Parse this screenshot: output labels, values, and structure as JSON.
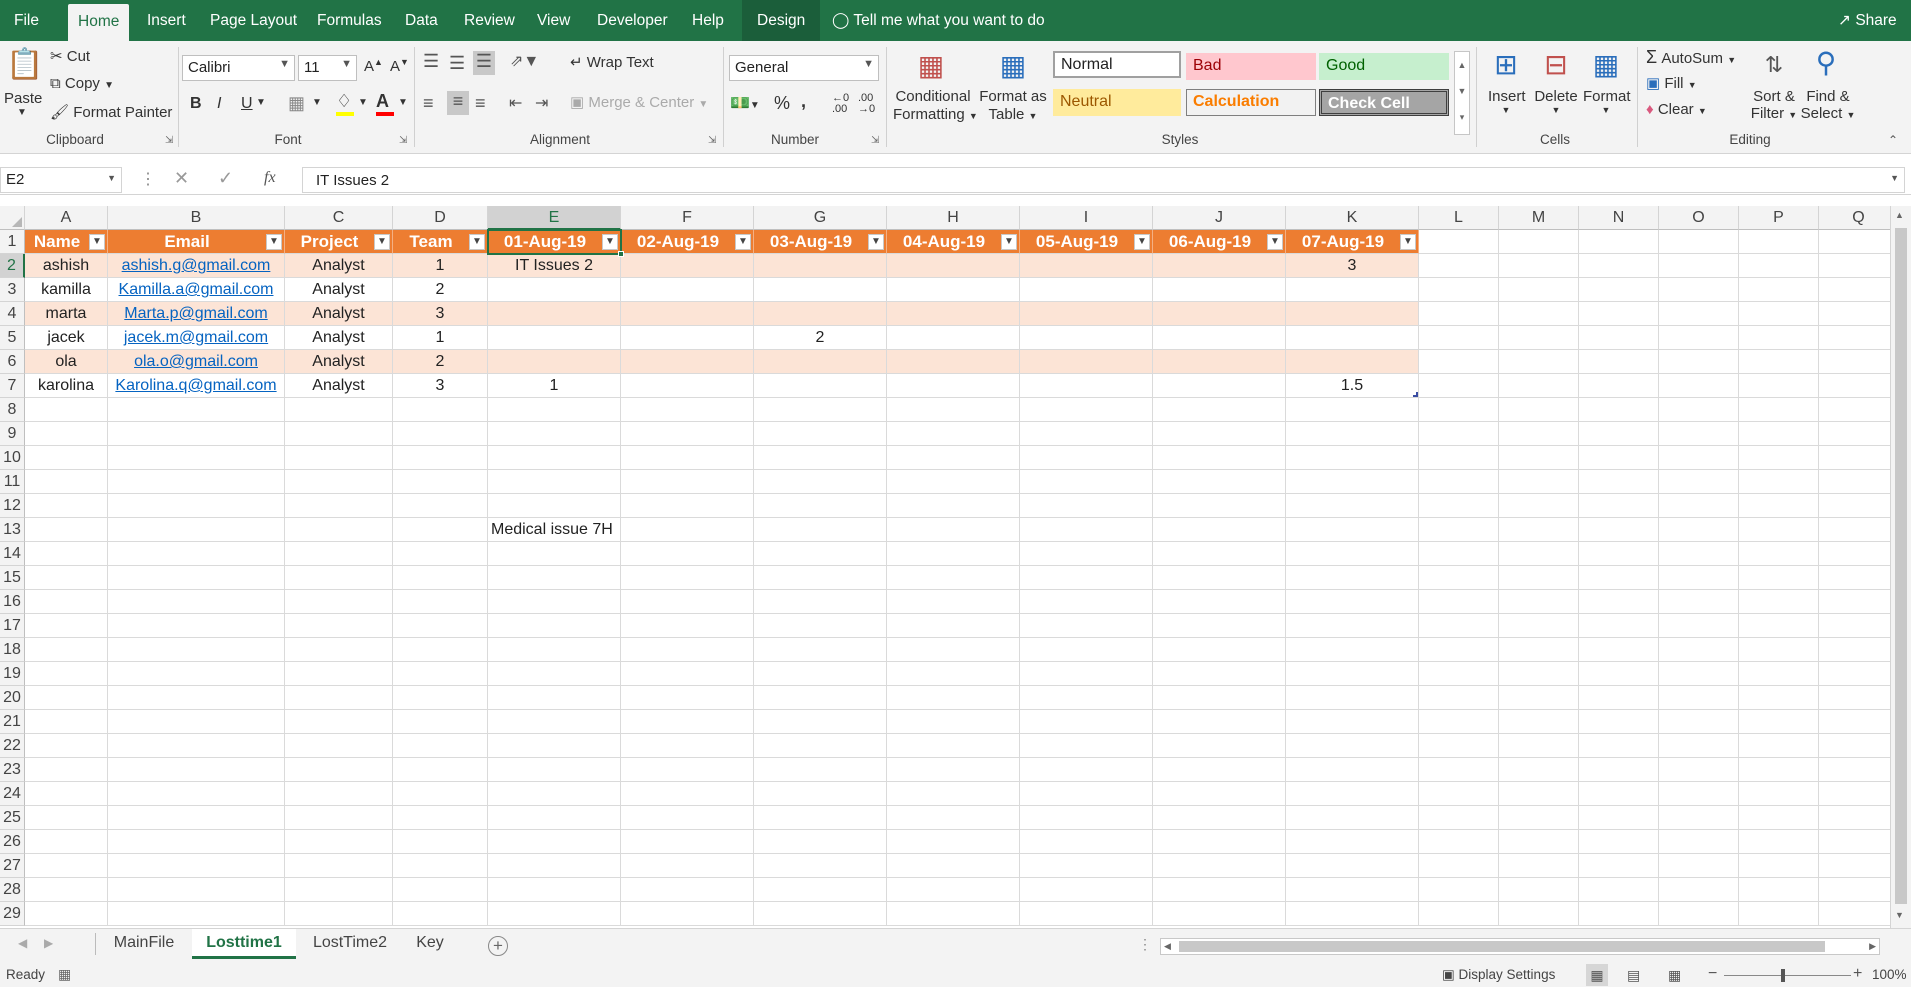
{
  "ribbon_tabs": [
    "File",
    "Home",
    "Insert",
    "Page Layout",
    "Formulas",
    "Data",
    "Review",
    "View",
    "Developer",
    "Help",
    "Design"
  ],
  "tell_me": "Tell me what you want to do",
  "share": "Share",
  "clipboard": {
    "paste": "Paste",
    "cut": "Cut",
    "copy": "Copy",
    "format_painter": "Format Painter",
    "label": "Clipboard"
  },
  "font": {
    "name": "Calibri",
    "size": "11",
    "label": "Font",
    "bold": "B",
    "italic": "I",
    "underline": "U"
  },
  "alignment": {
    "wrap": "Wrap Text",
    "merge": "Merge & Center",
    "label": "Alignment"
  },
  "number": {
    "format": "General",
    "label": "Number",
    "percent": "%",
    "comma": ","
  },
  "styles": {
    "conditional": "Conditional",
    "conditional2": "Formatting",
    "format_as": "Format as",
    "format_as2": "Table",
    "normal": "Normal",
    "bad": "Bad",
    "good": "Good",
    "neutral": "Neutral",
    "calculation": "Calculation",
    "check_cell": "Check Cell",
    "label": "Styles"
  },
  "cells": {
    "insert": "Insert",
    "delete": "Delete",
    "format": "Format",
    "label": "Cells"
  },
  "editing": {
    "autosum": "AutoSum",
    "fill": "Fill",
    "clear": "Clear",
    "sort": "Sort &",
    "sort2": "Filter",
    "find": "Find &",
    "find2": "Select",
    "label": "Editing"
  },
  "formula_bar": {
    "name_box": "E2",
    "fx": "fx",
    "content": "IT Issues 2"
  },
  "columns": [
    "A",
    "B",
    "C",
    "D",
    "E",
    "F",
    "G",
    "H",
    "I",
    "J",
    "K",
    "L",
    "M",
    "N",
    "O",
    "P",
    "Q"
  ],
  "rows": [
    "1",
    "2",
    "3",
    "4",
    "5",
    "6",
    "7",
    "8",
    "9",
    "10",
    "11",
    "12",
    "13",
    "14",
    "15",
    "16",
    "17",
    "18",
    "19",
    "20",
    "21",
    "22",
    "23",
    "24",
    "25",
    "26",
    "27",
    "28",
    "29"
  ],
  "table": {
    "headers": [
      "Name",
      "Email",
      "Project",
      "Team",
      "01-Aug-19",
      "02-Aug-19",
      "03-Aug-19",
      "04-Aug-19",
      "05-Aug-19",
      "06-Aug-19",
      "07-Aug-19"
    ],
    "rows": [
      [
        "ashish",
        "ashish.g@gmail.com",
        "Analyst",
        "1",
        "IT Issues 2",
        "",
        "",
        "",
        "",
        "",
        "3"
      ],
      [
        "kamilla",
        "Kamilla.a@gmail.com",
        "Analyst",
        "2",
        "",
        "",
        "",
        "",
        "",
        "",
        ""
      ],
      [
        "marta",
        "Marta.p@gmail.com",
        "Analyst",
        "3",
        "",
        "",
        "",
        "",
        "",
        "",
        ""
      ],
      [
        "jacek",
        "jacek.m@gmail.com",
        "Analyst",
        "1",
        "",
        "",
        "2",
        "",
        "",
        "",
        ""
      ],
      [
        "ola",
        "ola.o@gmail.com",
        "Analyst",
        "2",
        "",
        "",
        "",
        "",
        "",
        "",
        ""
      ],
      [
        "karolina",
        "Karolina.q@gmail.com",
        "Analyst",
        "3",
        "1",
        "",
        "",
        "",
        "",
        "",
        "1.5"
      ]
    ]
  },
  "extra_cell": "Medical issue 7H",
  "sheets": [
    "MainFile",
    "Losttime1",
    "LostTime2",
    "Key"
  ],
  "status": {
    "ready": "Ready",
    "display": "Display Settings",
    "zoom": "100%"
  },
  "colors": {
    "excel_green": "#217346",
    "header_orange": "#ed7d31",
    "band_peach": "#fce4d6"
  }
}
